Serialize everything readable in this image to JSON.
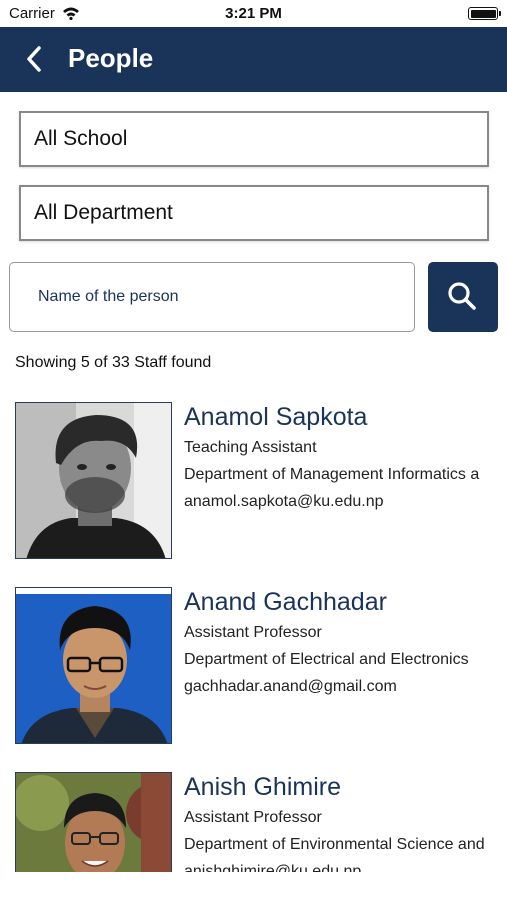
{
  "status_bar": {
    "carrier": "Carrier",
    "time": "3:21 PM"
  },
  "nav": {
    "title": "People",
    "back_icon": "chevron-left-icon"
  },
  "filters": {
    "school": "All School",
    "department": "All Department"
  },
  "search": {
    "placeholder": "Name of the person",
    "value": "",
    "button_icon": "search-icon"
  },
  "results": {
    "summary": "Showing 5 of 33 Staff found"
  },
  "staff": [
    {
      "name": "Anamol Sapkota",
      "role": "Teaching Assistant",
      "department": "Department of Management Informatics a",
      "email": "anamol.sapkota@ku.edu.np"
    },
    {
      "name": "Anand Gachhadar",
      "role": "Assistant Professor",
      "department": "Department of Electrical and Electronics",
      "email": "gachhadar.anand@gmail.com"
    },
    {
      "name": "Anish Ghimire",
      "role": "Assistant Professor",
      "department": "Department of Environmental Science and",
      "email": "anishghimire@ku.edu.np"
    }
  ],
  "colors": {
    "primary": "#1a3358",
    "background": "#ffffff",
    "border": "#888888"
  }
}
